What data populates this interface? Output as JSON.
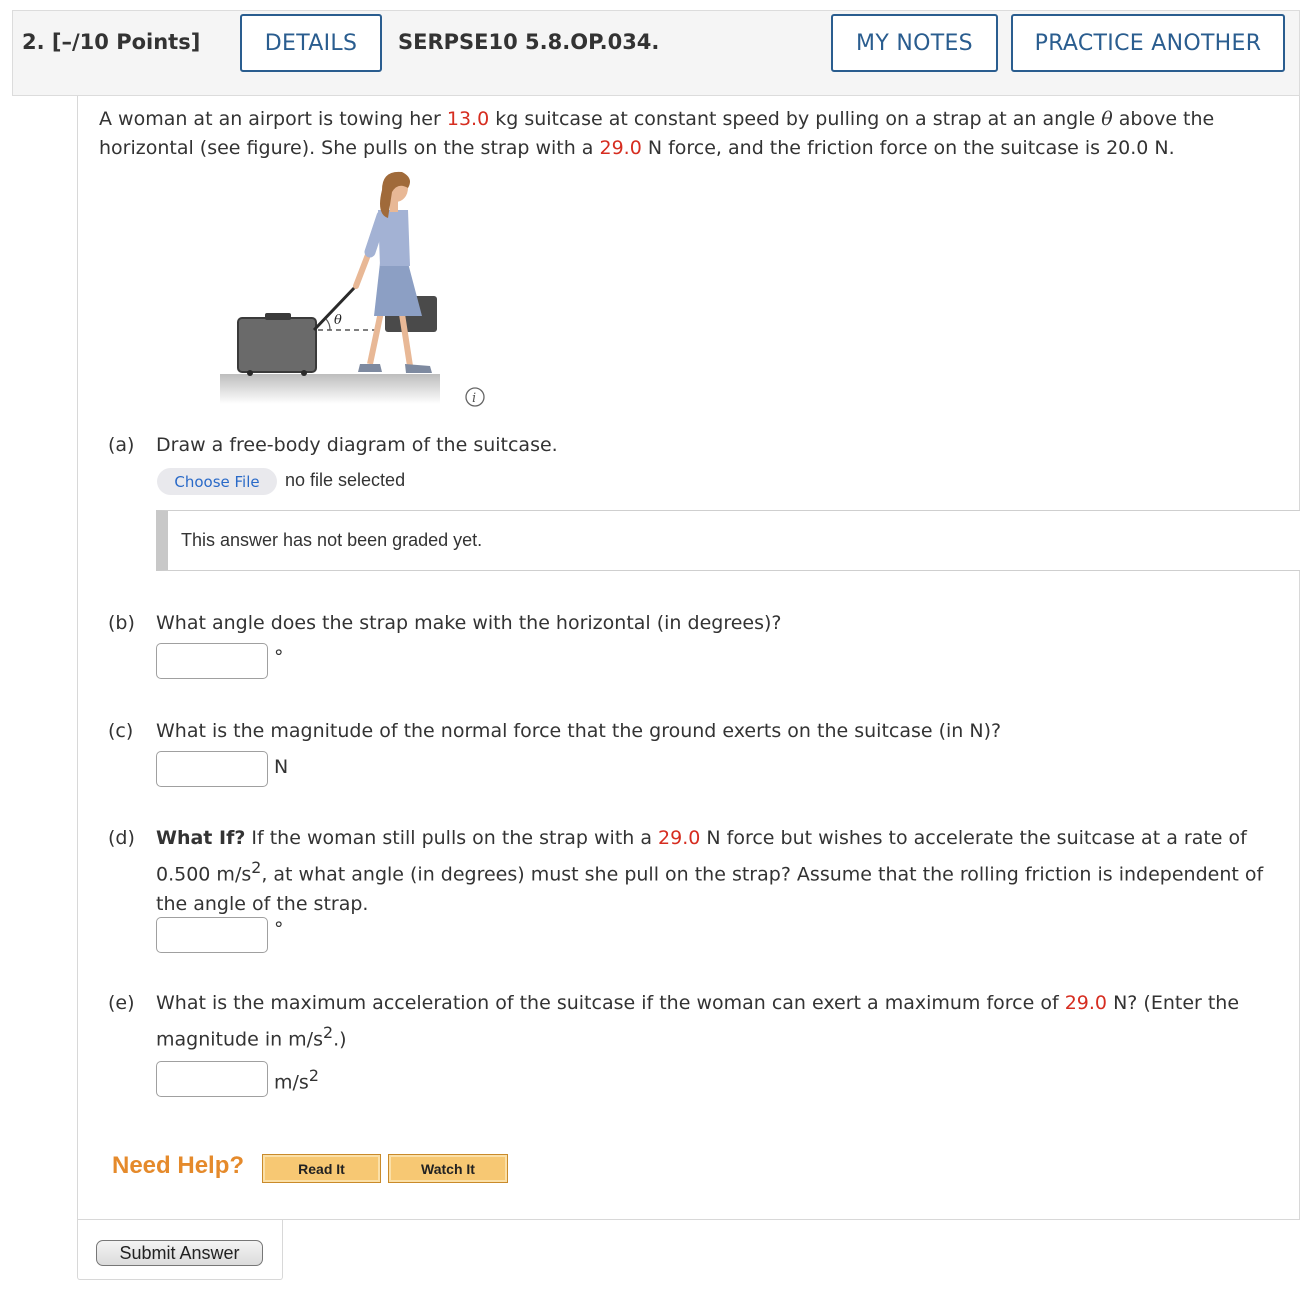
{
  "header": {
    "points_label": "2.  [–/10 Points]",
    "details_button": "DETAILS",
    "question_id": "SERPSE10 5.8.OP.034.",
    "my_notes_button": "MY NOTES",
    "practice_button": "PRACTICE ANOTHER"
  },
  "intro": {
    "t1": "A woman at an airport is towing her ",
    "mass": "13.0",
    "t2": " kg suitcase at constant speed by pulling on a strap at an angle ",
    "theta": "θ",
    "t3": " above the horizontal (see figure). She pulls on the strap with a ",
    "force": "29.0",
    "t4": " N force, and the friction force on the suitcase is 20.0 N."
  },
  "figure": {
    "angle_label": "θ",
    "info_icon": "i"
  },
  "part_a": {
    "letter": "(a)",
    "question": "Draw a free-body diagram of the suitcase.",
    "choose_file": "Choose File",
    "file_status": "no file selected",
    "graded_note": "This answer has not been graded yet."
  },
  "part_b": {
    "letter": "(b)",
    "question": "What angle does the strap make with the horizontal (in degrees)?",
    "unit": "°"
  },
  "part_c": {
    "letter": "(c)",
    "question": "What is the magnitude of the normal force that the ground exerts on the suitcase (in N)?",
    "unit": "N"
  },
  "part_d": {
    "letter": "(d)",
    "lead": "What If?",
    "t1": " If the woman still pulls on the strap with a ",
    "force": "29.0",
    "t2": " N force but wishes to accelerate the suitcase at a rate of",
    "t3": "0.500 m/s",
    "sup": "2",
    "t4": ", at what angle (in degrees) must she pull on the strap? Assume that the rolling friction is independent of",
    "t5": "the angle of the strap.",
    "unit": "°"
  },
  "part_e": {
    "letter": "(e)",
    "t1": "What is the maximum acceleration of the suitcase if the woman can exert a maximum force of ",
    "force": "29.0",
    "t2": " N? (Enter the",
    "t3": "magnitude in m/s",
    "sup": "2",
    "t4": ".)",
    "unit": "m/s",
    "unit_sup": "2"
  },
  "help": {
    "label": "Need Help?",
    "read_it": "Read It",
    "watch_it": "Watch It"
  },
  "submit": {
    "label": "Submit Answer"
  },
  "colors": {
    "accent_blue": "#2a5d8f",
    "value_red": "#d62d20",
    "help_orange": "#e58a2b"
  }
}
